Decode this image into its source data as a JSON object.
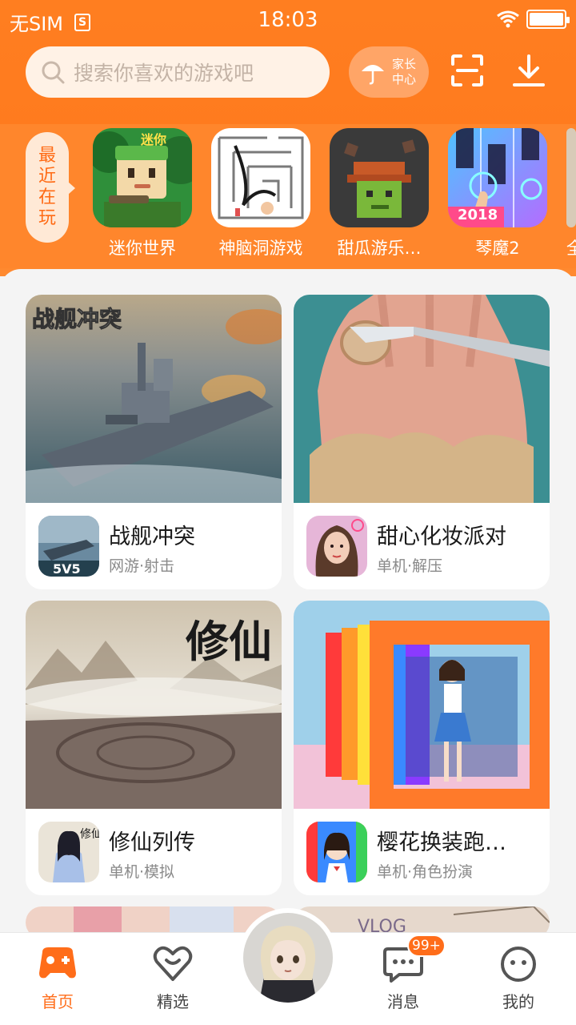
{
  "status_bar": {
    "carrier": "无SIM",
    "time": "18:03",
    "battery_level": 1.0
  },
  "search": {
    "placeholder": "搜索你喜欢的游戏吧"
  },
  "parent_center": {
    "label": "家长中心"
  },
  "recent": {
    "tag": "最近在玩",
    "items": [
      {
        "name": "迷你世界"
      },
      {
        "name": "神脑洞游戏"
      },
      {
        "name": "甜瓜游乐…"
      },
      {
        "name": "琴魔2",
        "badge": "2018"
      },
      {
        "name": "全"
      }
    ]
  },
  "cards": [
    {
      "title": "战舰冲突",
      "tags": "网游·射击",
      "art_text": "战舰冲突",
      "icon_text": "5V5"
    },
    {
      "title": "甜心化妆派对",
      "tags": "单机·解压"
    },
    {
      "title": "修仙列传",
      "tags": "单机·模拟",
      "art_text": "修仙",
      "icon_text": "修仙"
    },
    {
      "title": "樱花换装跑…",
      "tags": "单机·角色扮演"
    },
    {
      "title": "",
      "tags": "",
      "art_text": "VLOG"
    }
  ],
  "bottom_nav": {
    "items": [
      {
        "label": "首页",
        "active": true
      },
      {
        "label": "精选"
      },
      {
        "label": "消息",
        "badge": "99+"
      },
      {
        "label": "我的"
      }
    ]
  },
  "colors": {
    "accent": "#ff7a1e",
    "accent_text": "#ff6d1a"
  },
  "icons": [
    "search-icon",
    "umbrella-icon",
    "scan-icon",
    "download-icon",
    "wifi-icon",
    "battery-icon",
    "gamepad-icon",
    "heart-icon",
    "message-icon",
    "face-icon"
  ]
}
